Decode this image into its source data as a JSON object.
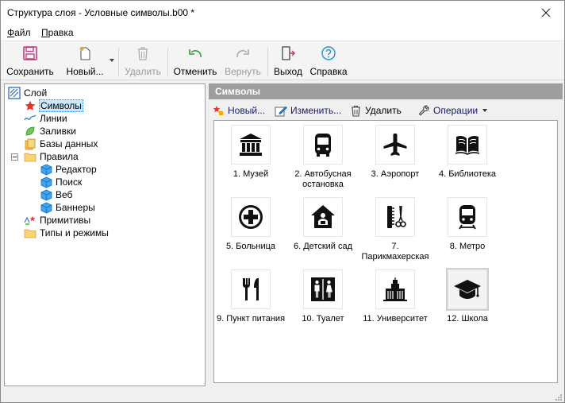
{
  "window": {
    "title": "Структура слоя - Условные символы.b00 *"
  },
  "menu": {
    "file": "Файл",
    "file_accel": "Ф",
    "file_rest": "айл",
    "edit_accel": "П",
    "edit_rest": "равка"
  },
  "toolbar": {
    "save": "Сохранить",
    "new": "Новый...",
    "delete": "Удалить",
    "undo": "Отменить",
    "redo": "Вернуть",
    "exit": "Выход",
    "help": "Справка"
  },
  "tree": {
    "root": "Слой",
    "items": [
      "Символы",
      "Линии",
      "Заливки",
      "Базы данных",
      "Правила",
      "Редактор",
      "Поиск",
      "Веб",
      "Баннеры",
      "Примитивы",
      "Типы и режимы"
    ]
  },
  "panel": {
    "header": "Символы",
    "new": "Новый...",
    "edit": "Изменить...",
    "delete": "Удалить",
    "operations": "Операции"
  },
  "symbols": [
    {
      "label": "1. Музей",
      "icon": "museum-icon"
    },
    {
      "label": "2. Автобусная остановка",
      "icon": "bus-icon"
    },
    {
      "label": "3. Аэропорт",
      "icon": "airplane-icon"
    },
    {
      "label": "4. Библиотека",
      "icon": "book-icon"
    },
    {
      "label": "5. Больница",
      "icon": "hospital-cross-icon"
    },
    {
      "label": "6. Детский сад",
      "icon": "kindergarten-icon"
    },
    {
      "label": "7. Парикмахерская",
      "icon": "barber-icon"
    },
    {
      "label": "8. Метро",
      "icon": "metro-icon"
    },
    {
      "label": "9. Пункт питания",
      "icon": "fork-knife-icon"
    },
    {
      "label": "10. Туалет",
      "icon": "toilet-icon"
    },
    {
      "label": "11. Университет",
      "icon": "university-icon"
    },
    {
      "label": "12. Школа",
      "icon": "graduation-cap-icon"
    }
  ]
}
